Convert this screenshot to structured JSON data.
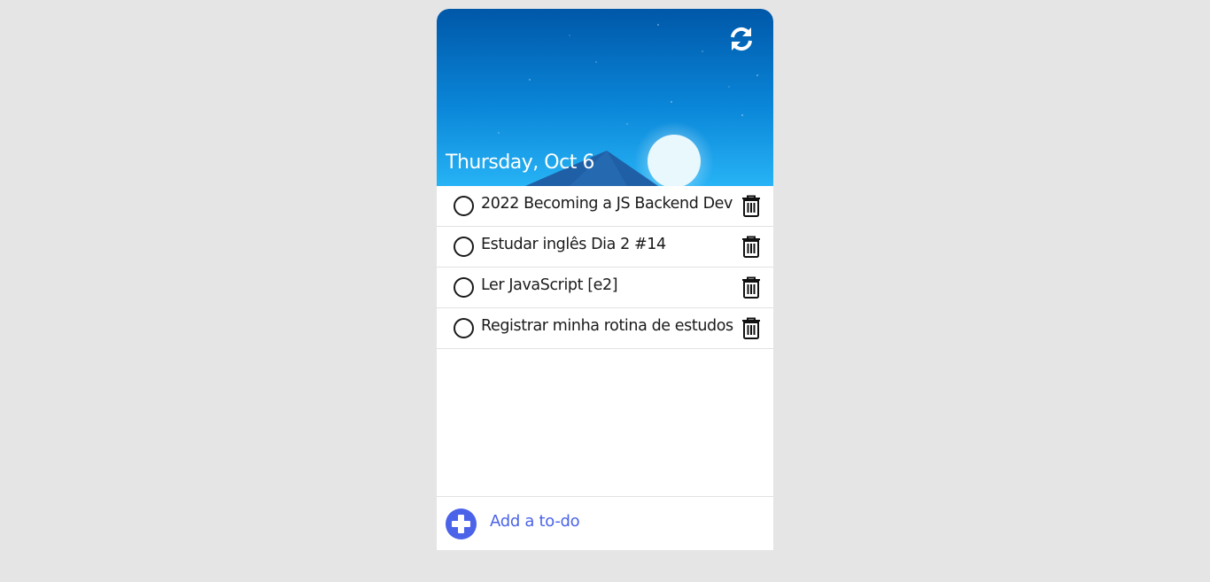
{
  "header": {
    "date": "Thursday, Oct 6",
    "refresh_icon": "refresh-icon"
  },
  "todos": [
    {
      "text": "2022 Becoming a JS Backend Dev",
      "done": false
    },
    {
      "text": "Estudar inglês Dia 2 #14",
      "done": false
    },
    {
      "text": "Ler JavaScript [e2]",
      "done": false
    },
    {
      "text": "Registrar minha rotina de estudos",
      "done": false
    }
  ],
  "footer": {
    "add_label": "Add a to-do",
    "add_icon": "plus-icon"
  },
  "colors": {
    "accent": "#4a63e8",
    "sky_top": "#0055a5",
    "sky_bottom": "#1ea7f0",
    "page_bg": "#e5e5e5"
  }
}
